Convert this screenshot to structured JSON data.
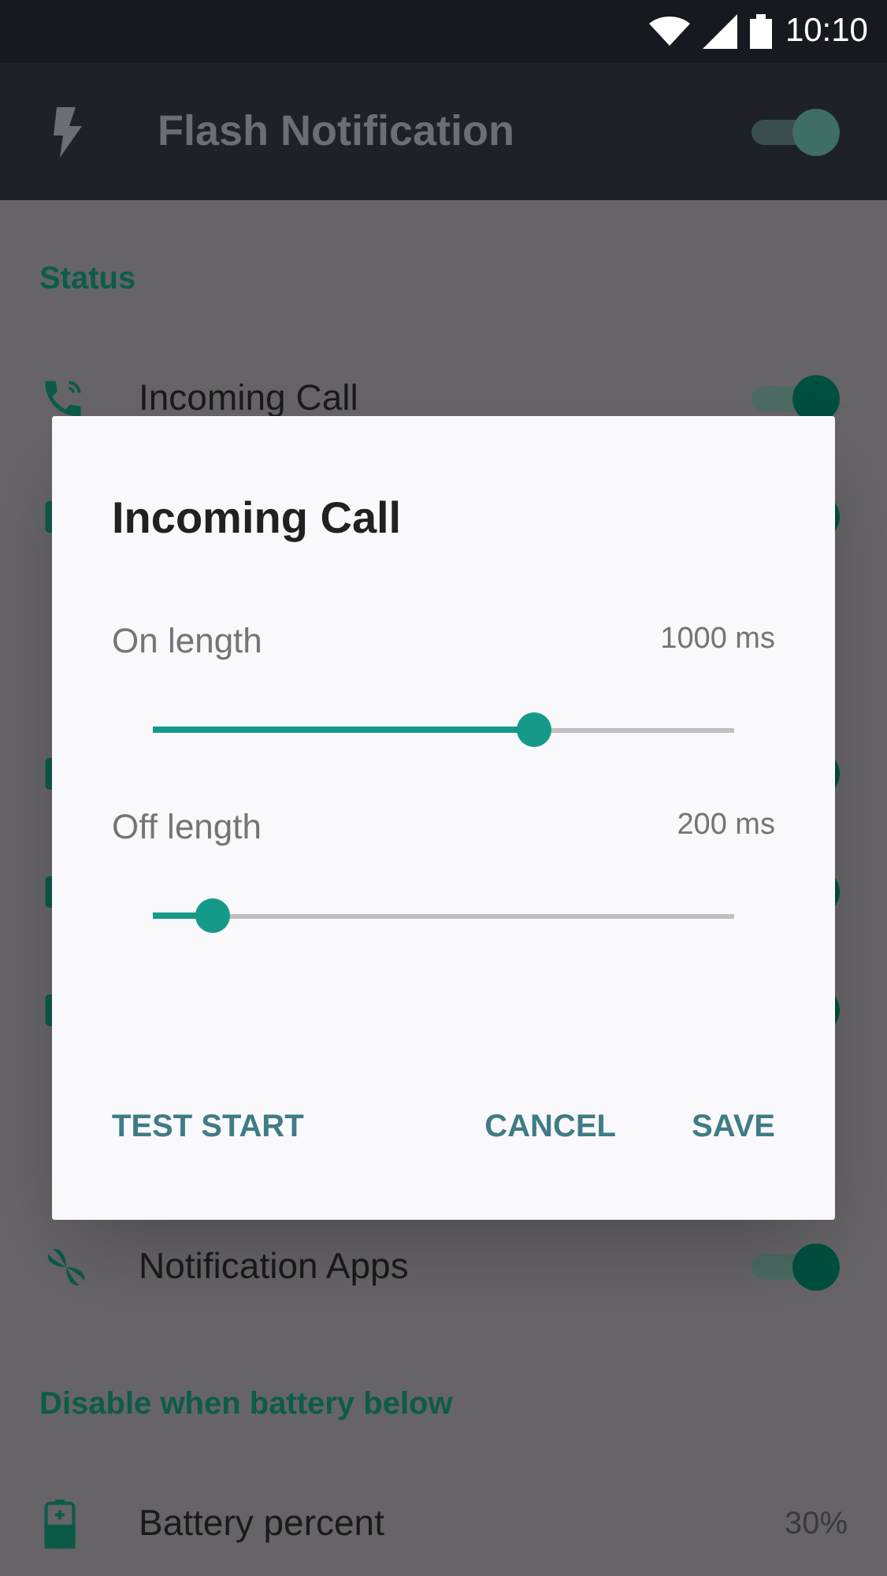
{
  "status_bar": {
    "time": "10:10"
  },
  "app_bar": {
    "title": "Flash Notification",
    "on": true
  },
  "sections": [
    {
      "title": "Status",
      "rows": [
        {
          "kind": "toggle",
          "label": "Incoming Call",
          "on": true
        },
        {
          "kind": "toggle",
          "on": true
        }
      ]
    },
    {
      "rows": [
        {
          "kind": "toggle",
          "on": true
        },
        {
          "kind": "toggle",
          "on": true
        },
        {
          "kind": "toggle",
          "on": true
        }
      ]
    },
    {
      "rows": [
        {
          "kind": "toggle",
          "label": "Notification Apps",
          "on": true
        }
      ]
    },
    {
      "title": "Disable when battery below",
      "rows": [
        {
          "kind": "value",
          "label": "Battery percent",
          "value": "30%"
        }
      ]
    }
  ],
  "dialog": {
    "title": "Incoming Call",
    "sliders": [
      {
        "label": "On length",
        "reading": "1000 ms",
        "level": 0.656
      },
      {
        "label": "Off length",
        "reading": "200 ms",
        "level": 0.103
      }
    ],
    "buttons": [
      "TEST START",
      "CANCEL",
      "SAVE"
    ]
  }
}
